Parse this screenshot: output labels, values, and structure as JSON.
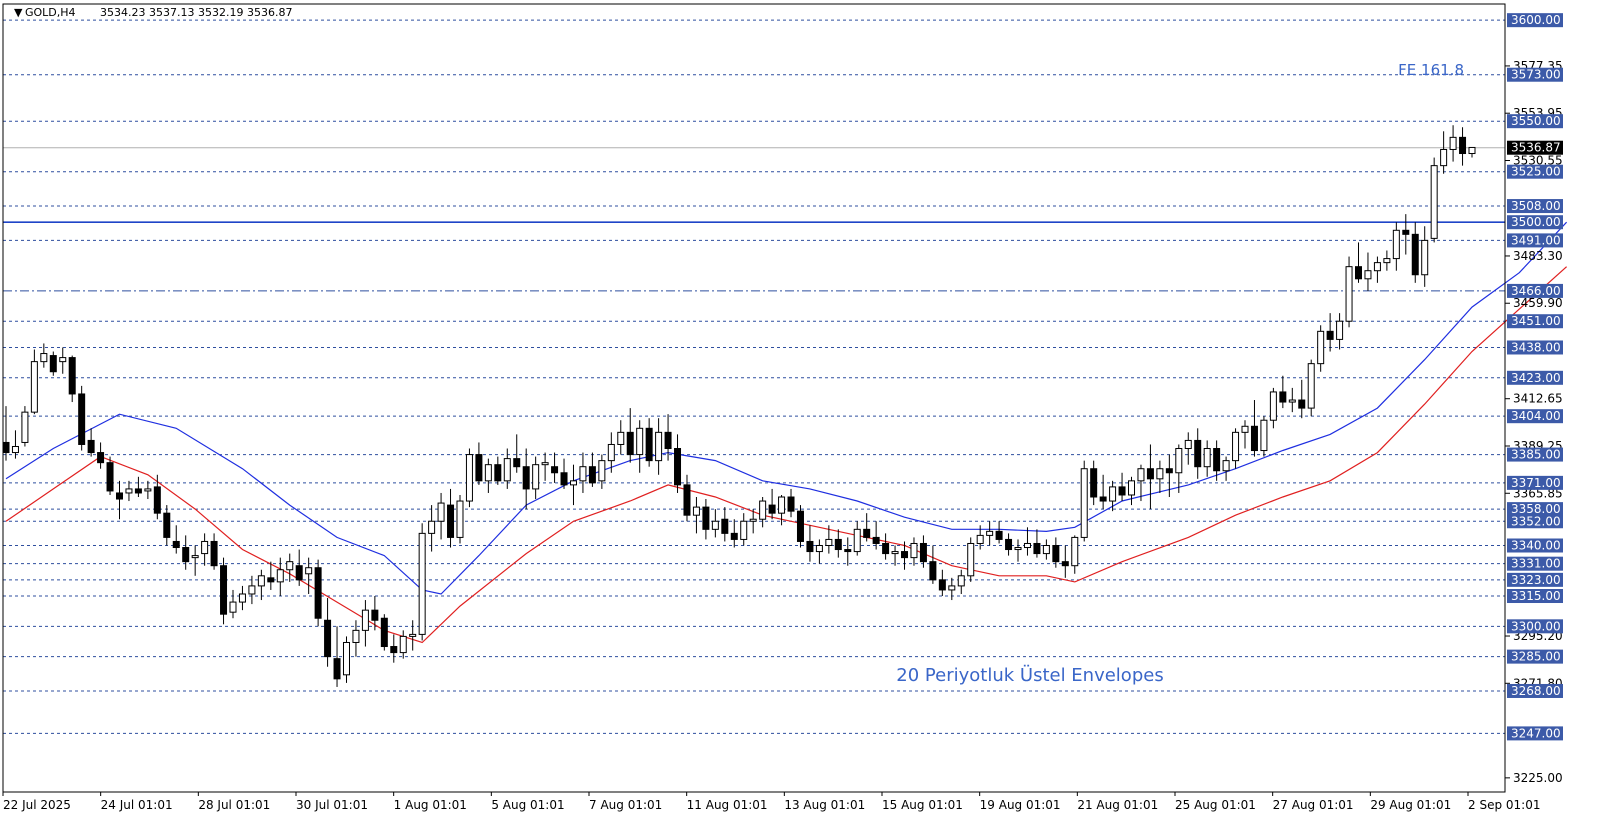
{
  "header": {
    "symbol": "GOLD,H4",
    "ohlc": "3534.23 3537.13 3532.19 3536.87"
  },
  "annotations": {
    "fe_label": "FE 161.8",
    "envelope_label": "20 Periyotluk Üstel Envelopes"
  },
  "colors": {
    "background": "#ffffff",
    "grid_dashed": "#2f4f9f",
    "level_box": "#3c5aa8",
    "upper_envelope": "#1f2fe0",
    "lower_envelope": "#e02020",
    "price_line": "#b0b0b0",
    "candle": "#000000",
    "annotation": "#3a66c8",
    "solid_level": "#1f44c8"
  },
  "chart_data": {
    "type": "candlestick",
    "symbol": "GOLD",
    "timeframe": "H4",
    "ylim": [
      3218,
      3608
    ],
    "y_ticks": [
      "3577.35",
      "3553.95",
      "3530.55",
      "3483.30",
      "3459.90",
      "3412.65",
      "3389.25",
      "3365.85",
      "3295.20",
      "3271.80",
      "3225.00"
    ],
    "x_labels": [
      "22 Jul 2025",
      "24 Jul 01:01",
      "28 Jul 01:01",
      "30 Jul 01:01",
      "1 Aug 01:01",
      "5 Aug 01:01",
      "7 Aug 01:01",
      "11 Aug 01:01",
      "13 Aug 01:01",
      "15 Aug 01:01",
      "19 Aug 01:01",
      "21 Aug 01:01",
      "25 Aug 01:01",
      "27 Aug 01:01",
      "29 Aug 01:01",
      "2 Sep 01:01"
    ],
    "levels": [
      {
        "value": 3600.0,
        "label": "3600.00",
        "style": "dashed"
      },
      {
        "value": 3573.0,
        "label": "3573.00",
        "style": "dashed"
      },
      {
        "value": 3550.0,
        "label": "3550.00",
        "style": "dashed"
      },
      {
        "value": 3525.0,
        "label": "3525.00",
        "style": "dashed"
      },
      {
        "value": 3508.0,
        "label": "3508.00",
        "style": "dashed"
      },
      {
        "value": 3500.0,
        "label": "3500.00",
        "style": "solid"
      },
      {
        "value": 3491.0,
        "label": "3491.00",
        "style": "dashed"
      },
      {
        "value": 3466.0,
        "label": "3466.00",
        "style": "dashdot"
      },
      {
        "value": 3451.0,
        "label": "3451.00",
        "style": "dashed"
      },
      {
        "value": 3438.0,
        "label": "3438.00",
        "style": "dashed"
      },
      {
        "value": 3423.0,
        "label": "3423.00",
        "style": "dashed"
      },
      {
        "value": 3404.0,
        "label": "3404.00",
        "style": "dashed"
      },
      {
        "value": 3385.0,
        "label": "3385.00",
        "style": "dashed"
      },
      {
        "value": 3371.0,
        "label": "3371.00",
        "style": "dashed"
      },
      {
        "value": 3358.0,
        "label": "3358.00",
        "style": "dashed"
      },
      {
        "value": 3352.0,
        "label": "3352.00",
        "style": "dashed"
      },
      {
        "value": 3340.0,
        "label": "3340.00",
        "style": "dashed"
      },
      {
        "value": 3331.0,
        "label": "3331.00",
        "style": "dashed"
      },
      {
        "value": 3323.0,
        "label": "3323.00",
        "style": "dashed"
      },
      {
        "value": 3315.0,
        "label": "3315.00",
        "style": "dashed"
      },
      {
        "value": 3300.0,
        "label": "3300.00",
        "style": "dashed"
      },
      {
        "value": 3285.0,
        "label": "3285.00",
        "style": "dashed"
      },
      {
        "value": 3268.0,
        "label": "3268.00",
        "style": "dashed"
      },
      {
        "value": 3247.0,
        "label": "3247.00",
        "style": "dashed"
      }
    ],
    "current_price": {
      "value": 3536.87,
      "label": "3536.87"
    },
    "candles": [
      [
        3391,
        3409,
        3382,
        3386
      ],
      [
        3386,
        3397,
        3383,
        3389
      ],
      [
        3391,
        3409,
        3389,
        3406
      ],
      [
        3406,
        3437,
        3405,
        3431
      ],
      [
        3431,
        3440,
        3428,
        3435
      ],
      [
        3434,
        3436,
        3424,
        3426
      ],
      [
        3431,
        3438,
        3425,
        3433
      ],
      [
        3433,
        3434,
        3411,
        3415
      ],
      [
        3415,
        3419,
        3387,
        3390
      ],
      [
        3392,
        3398,
        3384,
        3386
      ],
      [
        3386,
        3391,
        3378,
        3381
      ],
      [
        3381,
        3384,
        3365,
        3367
      ],
      [
        3366,
        3372,
        3353,
        3363
      ],
      [
        3366,
        3372,
        3362,
        3368
      ],
      [
        3368,
        3374,
        3364,
        3366
      ],
      [
        3367,
        3372,
        3363,
        3368
      ],
      [
        3369,
        3375,
        3353,
        3356
      ],
      [
        3356,
        3360,
        3340,
        3344
      ],
      [
        3342,
        3350,
        3336,
        3339
      ],
      [
        3339,
        3345,
        3328,
        3332
      ],
      [
        3334,
        3340,
        3325,
        3335
      ],
      [
        3336,
        3346,
        3330,
        3342
      ],
      [
        3342,
        3346,
        3328,
        3330
      ],
      [
        3330,
        3334,
        3301,
        3306
      ],
      [
        3307,
        3318,
        3304,
        3312
      ],
      [
        3312,
        3320,
        3308,
        3316
      ],
      [
        3316,
        3325,
        3311,
        3320
      ],
      [
        3320,
        3328,
        3313,
        3325
      ],
      [
        3324,
        3332,
        3318,
        3322
      ],
      [
        3322,
        3334,
        3315,
        3328
      ],
      [
        3328,
        3336,
        3322,
        3332
      ],
      [
        3330,
        3338,
        3320,
        3323
      ],
      [
        3326,
        3334,
        3316,
        3329
      ],
      [
        3329,
        3333,
        3300,
        3304
      ],
      [
        3303,
        3314,
        3280,
        3285
      ],
      [
        3284,
        3300,
        3270,
        3274
      ],
      [
        3276,
        3295,
        3272,
        3292
      ],
      [
        3292,
        3303,
        3285,
        3298
      ],
      [
        3298,
        3313,
        3290,
        3308
      ],
      [
        3308,
        3315,
        3298,
        3303
      ],
      [
        3304,
        3306,
        3288,
        3290
      ],
      [
        3290,
        3296,
        3282,
        3287
      ],
      [
        3287,
        3298,
        3284,
        3295
      ],
      [
        3295,
        3303,
        3288,
        3296
      ],
      [
        3296,
        3351,
        3293,
        3346
      ],
      [
        3346,
        3360,
        3337,
        3352
      ],
      [
        3352,
        3366,
        3343,
        3361
      ],
      [
        3360,
        3368,
        3339,
        3344
      ],
      [
        3344,
        3365,
        3341,
        3362
      ],
      [
        3362,
        3388,
        3359,
        3385
      ],
      [
        3385,
        3391,
        3370,
        3372
      ],
      [
        3372,
        3383,
        3366,
        3380
      ],
      [
        3380,
        3384,
        3370,
        3372
      ],
      [
        3372,
        3388,
        3368,
        3383
      ],
      [
        3383,
        3395,
        3376,
        3379
      ],
      [
        3379,
        3388,
        3358,
        3368
      ],
      [
        3368,
        3384,
        3363,
        3380
      ],
      [
        3380,
        3386,
        3372,
        3381
      ],
      [
        3379,
        3386,
        3371,
        3376
      ],
      [
        3376,
        3383,
        3368,
        3370
      ],
      [
        3370,
        3380,
        3360,
        3372
      ],
      [
        3372,
        3386,
        3366,
        3379
      ],
      [
        3379,
        3386,
        3369,
        3371
      ],
      [
        3372,
        3385,
        3368,
        3382
      ],
      [
        3382,
        3396,
        3376,
        3390
      ],
      [
        3390,
        3402,
        3385,
        3396
      ],
      [
        3396,
        3408,
        3381,
        3385
      ],
      [
        3385,
        3402,
        3376,
        3398
      ],
      [
        3398,
        3403,
        3379,
        3382
      ],
      [
        3382,
        3403,
        3375,
        3396
      ],
      [
        3396,
        3405,
        3382,
        3388
      ],
      [
        3388,
        3395,
        3366,
        3370
      ],
      [
        3370,
        3375,
        3352,
        3355
      ],
      [
        3355,
        3364,
        3346,
        3359
      ],
      [
        3359,
        3363,
        3343,
        3348
      ],
      [
        3348,
        3358,
        3344,
        3352
      ],
      [
        3353,
        3359,
        3342,
        3346
      ],
      [
        3346,
        3353,
        3339,
        3343
      ],
      [
        3343,
        3356,
        3340,
        3352
      ],
      [
        3352,
        3358,
        3346,
        3353
      ],
      [
        3353,
        3364,
        3349,
        3362
      ],
      [
        3360,
        3368,
        3353,
        3356
      ],
      [
        3356,
        3365,
        3350,
        3364
      ],
      [
        3364,
        3368,
        3354,
        3357
      ],
      [
        3357,
        3360,
        3339,
        3342
      ],
      [
        3342,
        3350,
        3332,
        3337
      ],
      [
        3337,
        3343,
        3331,
        3340
      ],
      [
        3340,
        3350,
        3336,
        3343
      ],
      [
        3343,
        3348,
        3334,
        3338
      ],
      [
        3338,
        3344,
        3330,
        3337
      ],
      [
        3337,
        3352,
        3335,
        3348
      ],
      [
        3348,
        3356,
        3342,
        3344
      ],
      [
        3344,
        3352,
        3338,
        3341
      ],
      [
        3341,
        3346,
        3333,
        3336
      ],
      [
        3336,
        3340,
        3330,
        3337
      ],
      [
        3337,
        3342,
        3328,
        3334
      ],
      [
        3334,
        3344,
        3330,
        3341
      ],
      [
        3341,
        3345,
        3329,
        3332
      ],
      [
        3332,
        3340,
        3321,
        3323
      ],
      [
        3323,
        3328,
        3315,
        3318
      ],
      [
        3318,
        3324,
        3313,
        3320
      ],
      [
        3320,
        3328,
        3316,
        3325
      ],
      [
        3325,
        3344,
        3322,
        3341
      ],
      [
        3341,
        3350,
        3338,
        3345
      ],
      [
        3345,
        3352,
        3340,
        3347
      ],
      [
        3347,
        3352,
        3341,
        3343
      ],
      [
        3343,
        3346,
        3335,
        3338
      ],
      [
        3338,
        3343,
        3332,
        3339
      ],
      [
        3339,
        3349,
        3335,
        3341
      ],
      [
        3341,
        3348,
        3334,
        3336
      ],
      [
        3336,
        3343,
        3333,
        3340
      ],
      [
        3340,
        3344,
        3329,
        3332
      ],
      [
        3332,
        3340,
        3324,
        3330
      ],
      [
        3330,
        3345,
        3326,
        3344
      ],
      [
        3344,
        3382,
        3342,
        3378
      ],
      [
        3378,
        3382,
        3360,
        3364
      ],
      [
        3364,
        3375,
        3358,
        3362
      ],
      [
        3362,
        3372,
        3357,
        3369
      ],
      [
        3369,
        3376,
        3362,
        3365
      ],
      [
        3365,
        3374,
        3360,
        3372
      ],
      [
        3372,
        3380,
        3362,
        3378
      ],
      [
        3378,
        3390,
        3358,
        3373
      ],
      [
        3373,
        3382,
        3366,
        3378
      ],
      [
        3378,
        3385,
        3364,
        3376
      ],
      [
        3376,
        3390,
        3366,
        3388
      ],
      [
        3388,
        3396,
        3380,
        3392
      ],
      [
        3392,
        3398,
        3373,
        3379
      ],
      [
        3379,
        3392,
        3374,
        3388
      ],
      [
        3388,
        3392,
        3372,
        3377
      ],
      [
        3377,
        3384,
        3372,
        3382
      ],
      [
        3382,
        3398,
        3378,
        3396
      ],
      [
        3396,
        3402,
        3388,
        3399
      ],
      [
        3399,
        3412,
        3384,
        3387
      ],
      [
        3387,
        3404,
        3384,
        3402
      ],
      [
        3402,
        3418,
        3398,
        3416
      ],
      [
        3416,
        3424,
        3408,
        3411
      ],
      [
        3411,
        3418,
        3406,
        3412
      ],
      [
        3412,
        3422,
        3403,
        3408
      ],
      [
        3408,
        3432,
        3404,
        3430
      ],
      [
        3430,
        3449,
        3426,
        3446
      ],
      [
        3446,
        3455,
        3436,
        3442
      ],
      [
        3442,
        3455,
        3437,
        3451
      ],
      [
        3451,
        3483,
        3448,
        3478
      ],
      [
        3478,
        3490,
        3470,
        3472
      ],
      [
        3472,
        3485,
        3466,
        3476
      ],
      [
        3476,
        3483,
        3470,
        3480
      ],
      [
        3480,
        3486,
        3476,
        3482
      ],
      [
        3482,
        3500,
        3476,
        3496
      ],
      [
        3496,
        3504,
        3484,
        3494
      ],
      [
        3494,
        3500,
        3470,
        3474
      ],
      [
        3474,
        3498,
        3468,
        3491
      ],
      [
        3492,
        3532,
        3490,
        3528
      ],
      [
        3528,
        3545,
        3524,
        3536
      ],
      [
        3536,
        3548,
        3530,
        3542
      ],
      [
        3542,
        3547,
        3528,
        3534
      ],
      [
        3534,
        3537,
        3532,
        3537
      ]
    ],
    "upper_envelope": [
      [
        0,
        3373
      ],
      [
        5,
        3388
      ],
      [
        12,
        3405
      ],
      [
        18,
        3398
      ],
      [
        25,
        3378
      ],
      [
        30,
        3360
      ],
      [
        35,
        3344
      ],
      [
        40,
        3335
      ],
      [
        44,
        3318
      ],
      [
        46,
        3316
      ],
      [
        50,
        3335
      ],
      [
        55,
        3360
      ],
      [
        60,
        3372
      ],
      [
        66,
        3382
      ],
      [
        70,
        3386
      ],
      [
        75,
        3382
      ],
      [
        80,
        3372
      ],
      [
        85,
        3368
      ],
      [
        90,
        3362
      ],
      [
        95,
        3354
      ],
      [
        100,
        3348
      ],
      [
        105,
        3348
      ],
      [
        110,
        3347
      ],
      [
        113,
        3349
      ],
      [
        118,
        3362
      ],
      [
        125,
        3370
      ],
      [
        130,
        3378
      ],
      [
        135,
        3387
      ],
      [
        140,
        3395
      ],
      [
        145,
        3408
      ],
      [
        150,
        3432
      ],
      [
        155,
        3458
      ],
      [
        160,
        3475
      ],
      [
        165,
        3500
      ]
    ],
    "lower_envelope": [
      [
        0,
        3352
      ],
      [
        5,
        3368
      ],
      [
        10,
        3384
      ],
      [
        15,
        3375
      ],
      [
        20,
        3358
      ],
      [
        25,
        3338
      ],
      [
        30,
        3326
      ],
      [
        35,
        3312
      ],
      [
        40,
        3298
      ],
      [
        44,
        3292
      ],
      [
        48,
        3310
      ],
      [
        55,
        3336
      ],
      [
        60,
        3352
      ],
      [
        66,
        3362
      ],
      [
        70,
        3370
      ],
      [
        75,
        3364
      ],
      [
        80,
        3355
      ],
      [
        85,
        3350
      ],
      [
        90,
        3345
      ],
      [
        95,
        3340
      ],
      [
        100,
        3330
      ],
      [
        105,
        3325
      ],
      [
        110,
        3325
      ],
      [
        113,
        3322
      ],
      [
        118,
        3332
      ],
      [
        125,
        3344
      ],
      [
        130,
        3355
      ],
      [
        135,
        3364
      ],
      [
        140,
        3372
      ],
      [
        145,
        3386
      ],
      [
        150,
        3410
      ],
      [
        155,
        3436
      ],
      [
        160,
        3457
      ],
      [
        165,
        3478
      ]
    ]
  }
}
